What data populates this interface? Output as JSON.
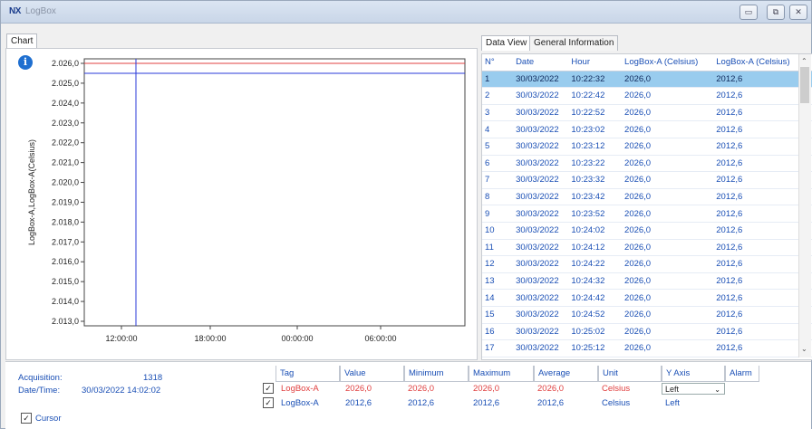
{
  "window": {
    "logo": "NX",
    "title": "LogBox",
    "buttons": [
      "▭",
      "⧉",
      "✕"
    ]
  },
  "left_tab": "Chart",
  "right_tabs": [
    "Data View",
    "General Information"
  ],
  "chart_data": {
    "type": "line",
    "ylabel": "LogBox-A,LogBox-A(Celsius)",
    "y_ticks": [
      "2.026,0",
      "2.025,0",
      "2.024,0",
      "2.023,0",
      "2.022,0",
      "2.021,0",
      "2.020,0",
      "2.019,0",
      "2.018,0",
      "2.017,0",
      "2.016,0",
      "2.015,0",
      "2.014,0",
      "2.013,0"
    ],
    "x_ticks": [
      "12:00:00",
      "18:00:00",
      "00:00:00",
      "06:00:00"
    ],
    "series": [
      {
        "values": [
          2026.0,
          2026.0
        ],
        "color": "#e04040"
      },
      {
        "values": [
          2025.5,
          2025.5
        ],
        "color": "#2a3ad8"
      }
    ],
    "cursor_color": "#2a3ad8"
  },
  "data_view": {
    "columns": [
      "N°",
      "Date",
      "Hour",
      "LogBox-A (Celsius)",
      "LogBox-A (Celsius)"
    ],
    "rows": [
      [
        "1",
        "30/03/2022",
        "10:22:32",
        "2026,0",
        "2012,6"
      ],
      [
        "2",
        "30/03/2022",
        "10:22:42",
        "2026,0",
        "2012,6"
      ],
      [
        "3",
        "30/03/2022",
        "10:22:52",
        "2026,0",
        "2012,6"
      ],
      [
        "4",
        "30/03/2022",
        "10:23:02",
        "2026,0",
        "2012,6"
      ],
      [
        "5",
        "30/03/2022",
        "10:23:12",
        "2026,0",
        "2012,6"
      ],
      [
        "6",
        "30/03/2022",
        "10:23:22",
        "2026,0",
        "2012,6"
      ],
      [
        "7",
        "30/03/2022",
        "10:23:32",
        "2026,0",
        "2012,6"
      ],
      [
        "8",
        "30/03/2022",
        "10:23:42",
        "2026,0",
        "2012,6"
      ],
      [
        "9",
        "30/03/2022",
        "10:23:52",
        "2026,0",
        "2012,6"
      ],
      [
        "10",
        "30/03/2022",
        "10:24:02",
        "2026,0",
        "2012,6"
      ],
      [
        "11",
        "30/03/2022",
        "10:24:12",
        "2026,0",
        "2012,6"
      ],
      [
        "12",
        "30/03/2022",
        "10:24:22",
        "2026,0",
        "2012,6"
      ],
      [
        "13",
        "30/03/2022",
        "10:24:32",
        "2026,0",
        "2012,6"
      ],
      [
        "14",
        "30/03/2022",
        "10:24:42",
        "2026,0",
        "2012,6"
      ],
      [
        "15",
        "30/03/2022",
        "10:24:52",
        "2026,0",
        "2012,6"
      ],
      [
        "16",
        "30/03/2022",
        "10:25:02",
        "2026,0",
        "2012,6"
      ],
      [
        "17",
        "30/03/2022",
        "10:25:12",
        "2026,0",
        "2012,6"
      ]
    ]
  },
  "info": {
    "acquisition_label": "Acquisition:",
    "acquisition_value": "1318",
    "datetime_label": "Date/Time:",
    "datetime_value": "30/03/2022 14:02:02",
    "cursor_label": "Cursor"
  },
  "tags": {
    "columns": [
      "Tag",
      "Value",
      "Minimum",
      "Maximum",
      "Average",
      "Unit",
      "Y Axis",
      "Alarm"
    ],
    "rows": [
      {
        "tag": "LogBox-A",
        "value": "2026,0",
        "minimum": "2026,0",
        "maximum": "2026,0",
        "average": "2026,0",
        "unit": "Celsius",
        "y_axis": "Left",
        "color": "#e04040"
      },
      {
        "tag": "LogBox-A",
        "value": "2012,6",
        "minimum": "2012,6",
        "maximum": "2012,6",
        "average": "2012,6",
        "unit": "Celsius",
        "y_axis": "Left",
        "color": "#1a4fb5"
      }
    ]
  },
  "colors": {
    "selection": "#99ccee",
    "link_text": "#1a4fb5",
    "alert_text": "#e04040"
  }
}
